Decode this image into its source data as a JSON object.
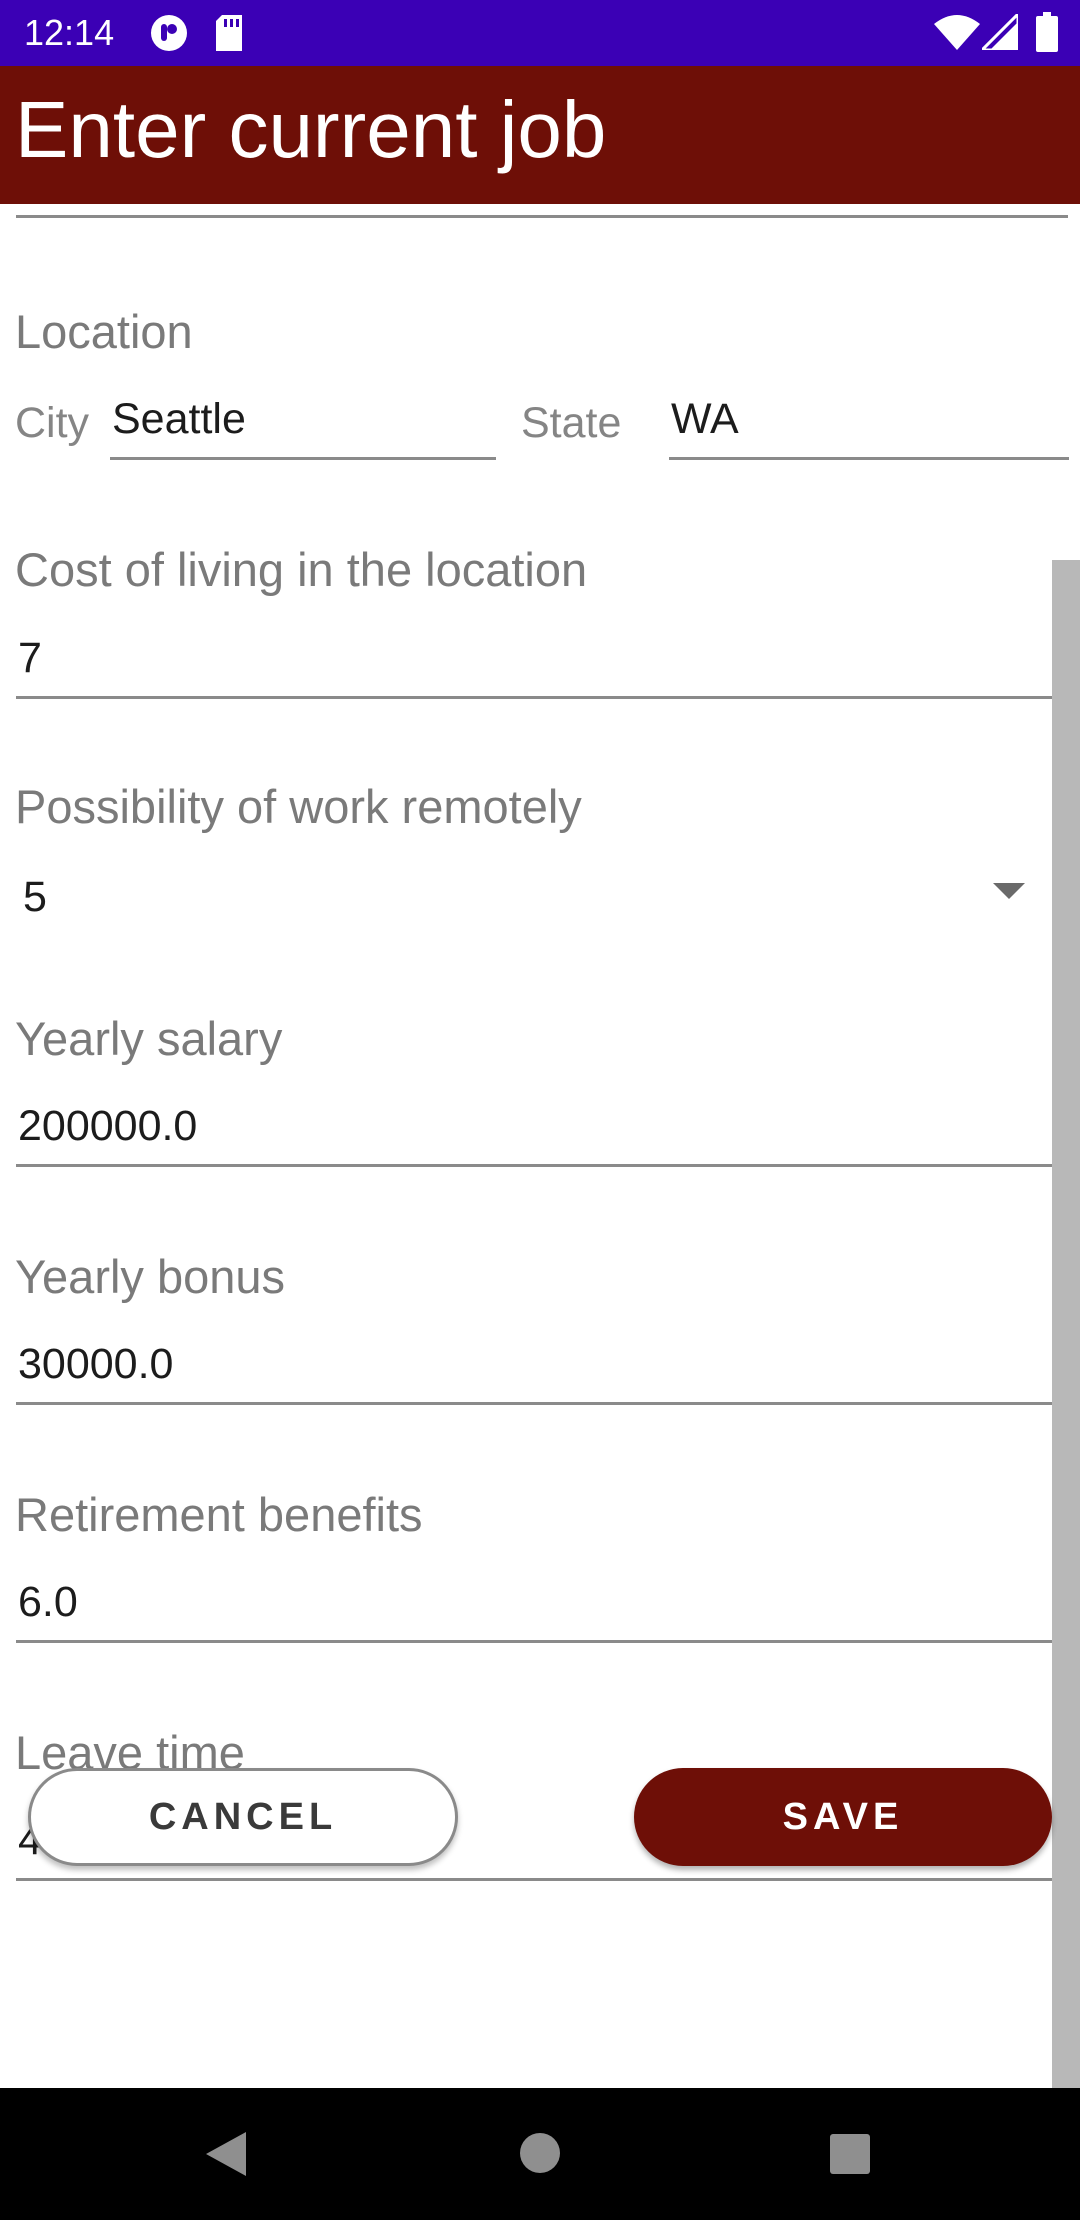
{
  "status_bar": {
    "time": "12:14",
    "icons": [
      "recorder-icon",
      "sd-card-icon",
      "wifi-icon",
      "signal-icon",
      "battery-icon"
    ]
  },
  "app_bar": {
    "title": "Enter current job",
    "background": "#6e0f07"
  },
  "form": {
    "location": {
      "label": "Location",
      "city_label": "City",
      "city_value": "Seattle",
      "state_label": "State",
      "state_value": "WA"
    },
    "cost_of_living": {
      "label": "Cost of living in the location",
      "value": "7"
    },
    "remote_work": {
      "label": "Possibility of work remotely",
      "selected": "5"
    },
    "yearly_salary": {
      "label": "Yearly salary",
      "value": "200000.0"
    },
    "yearly_bonus": {
      "label": "Yearly bonus",
      "value": "30000.0"
    },
    "retirement": {
      "label": "Retirement benefits",
      "value": "6.0"
    },
    "leave_time": {
      "label": "Leave time",
      "value": "40"
    }
  },
  "actions": {
    "cancel_label": "CANCEL",
    "save_label": "SAVE"
  },
  "nav_bar": {
    "icons": [
      "back-icon",
      "home-icon",
      "recents-icon"
    ]
  },
  "colors": {
    "status_bar": "#3b00b5",
    "accent": "#6e0f07",
    "scrollbar": "#b8b8b8"
  }
}
